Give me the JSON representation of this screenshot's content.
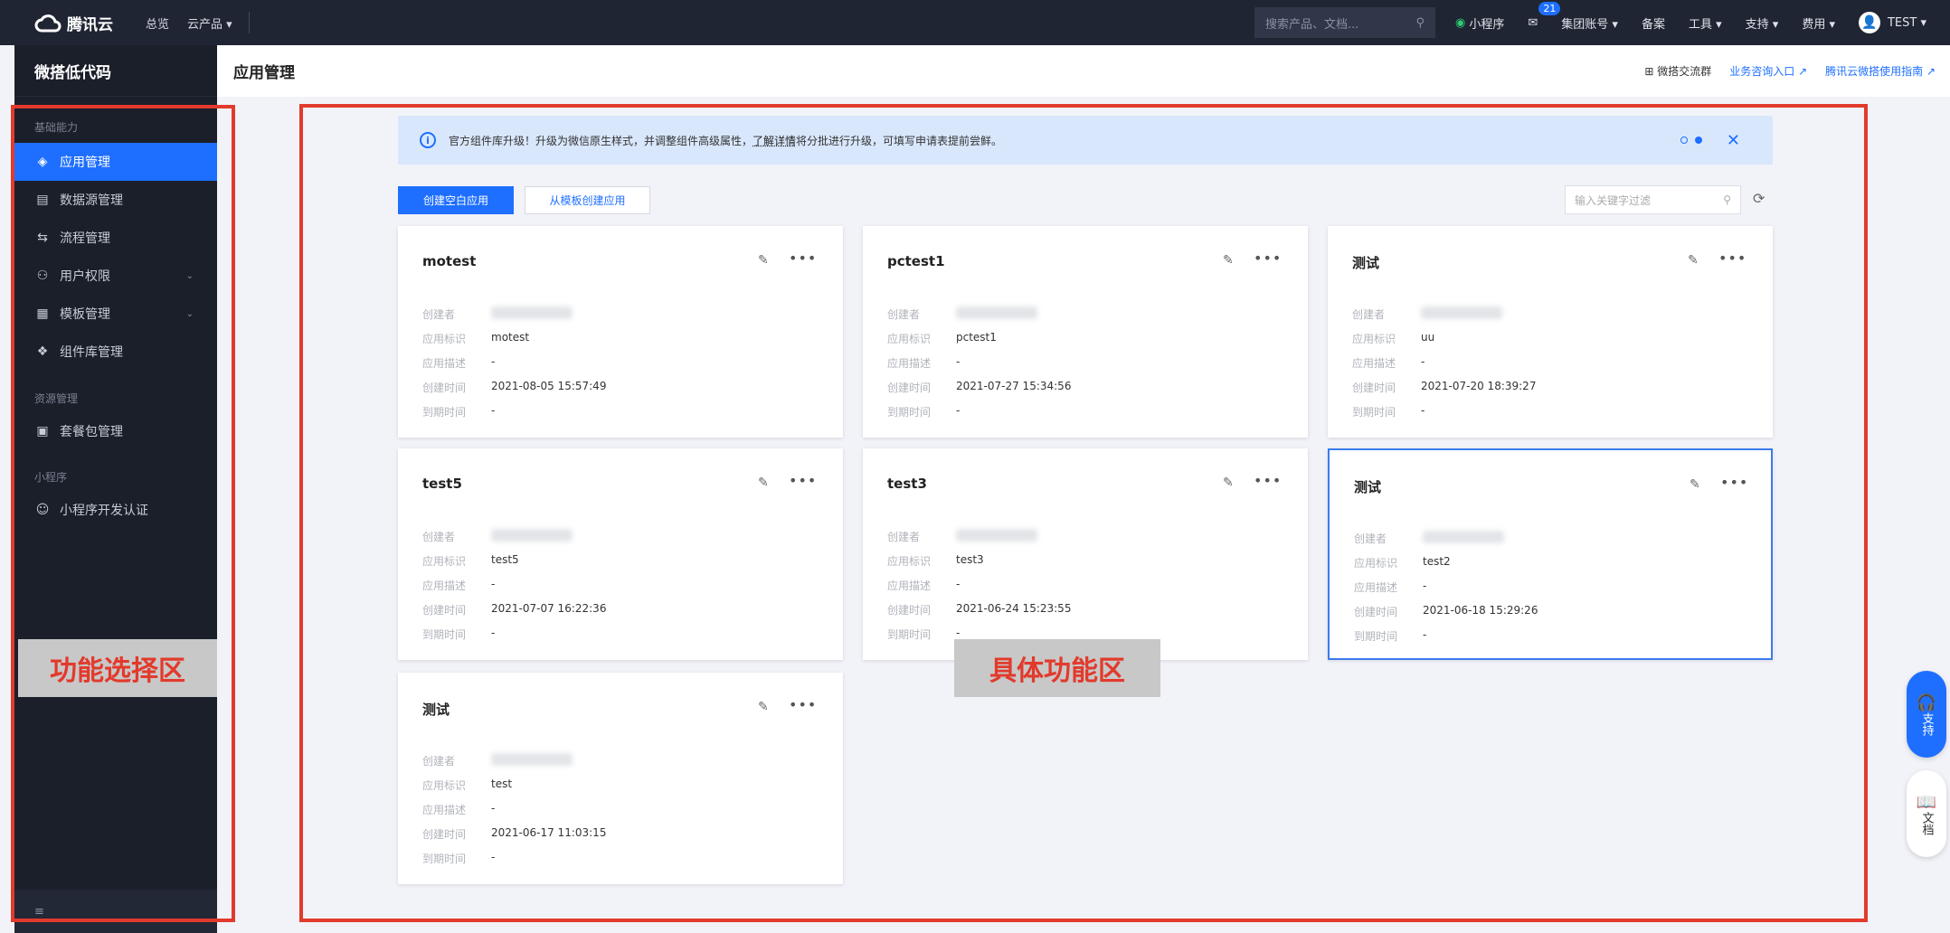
{
  "topbar": {
    "brand": "腾讯云",
    "nav": [
      "总览",
      "云产品 ▾"
    ],
    "search_placeholder": "搜索产品、文档...",
    "items": {
      "miniprogram": "小程序",
      "mail_badge": "21",
      "group_account": "集团账号 ▾",
      "beian": "备案",
      "tools": "工具 ▾",
      "support": "支持 ▾",
      "billing": "费用 ▾",
      "user": "TEST ▾"
    }
  },
  "sidebar": {
    "title": "微搭低代码",
    "groups": {
      "basic": "基础能力",
      "resource": "资源管理",
      "mini": "小程序"
    },
    "items": [
      {
        "label": "应用管理",
        "icon": "◈"
      },
      {
        "label": "数据源管理",
        "icon": "▤"
      },
      {
        "label": "流程管理",
        "icon": "⇆"
      },
      {
        "label": "用户权限",
        "icon": "⚇"
      },
      {
        "label": "模板管理",
        "icon": "▦"
      },
      {
        "label": "组件库管理",
        "icon": "❖"
      },
      {
        "label": "套餐包管理",
        "icon": "▣"
      },
      {
        "label": "小程序开发认证",
        "icon": "☺"
      }
    ],
    "footer_icon": "≡"
  },
  "header": {
    "title": "应用管理",
    "links": {
      "group": "微搭交流群",
      "consult": "业务咨询入口 ↗",
      "guide": "腾讯云微搭使用指南 ↗"
    }
  },
  "banner": {
    "text1": "官方组件库升级！升级为微信原生样式，并调整组件高级属性，",
    "link": "了解详情",
    "text2": "将分批进行升级，可填写申请表提前尝鲜。",
    "close": "✕"
  },
  "toolbar": {
    "create_blank": "创建空白应用",
    "create_template": "从模板创建应用",
    "filter_placeholder": "输入关键字过滤"
  },
  "field_labels": {
    "creator": "创建者",
    "id": "应用标识",
    "desc": "应用描述",
    "created": "创建时间",
    "expire": "到期时间"
  },
  "cards": [
    {
      "title": "motest",
      "id": "motest",
      "desc": "-",
      "created": "2021-08-05 15:57:49",
      "expire": "-"
    },
    {
      "title": "pctest1",
      "id": "pctest1",
      "desc": "-",
      "created": "2021-07-27 15:34:56",
      "expire": "-"
    },
    {
      "title": "测试",
      "id": "uu",
      "desc": "-",
      "created": "2021-07-20 18:39:27",
      "expire": "-"
    },
    {
      "title": "test5",
      "id": "test5",
      "desc": "-",
      "created": "2021-07-07 16:22:36",
      "expire": "-"
    },
    {
      "title": "test3",
      "id": "test3",
      "desc": "-",
      "created": "2021-06-24 15:23:55",
      "expire": "-"
    },
    {
      "title": "测试",
      "id": "test2",
      "desc": "-",
      "created": "2021-06-18 15:29:26",
      "expire": "-"
    },
    {
      "title": "测试",
      "id": "test",
      "desc": "-",
      "created": "2021-06-17 11:03:15",
      "expire": "-"
    }
  ],
  "annotations": {
    "left": "功能选择区",
    "right": "具体功能区"
  },
  "float": {
    "support": "支持",
    "docs": "文档"
  }
}
